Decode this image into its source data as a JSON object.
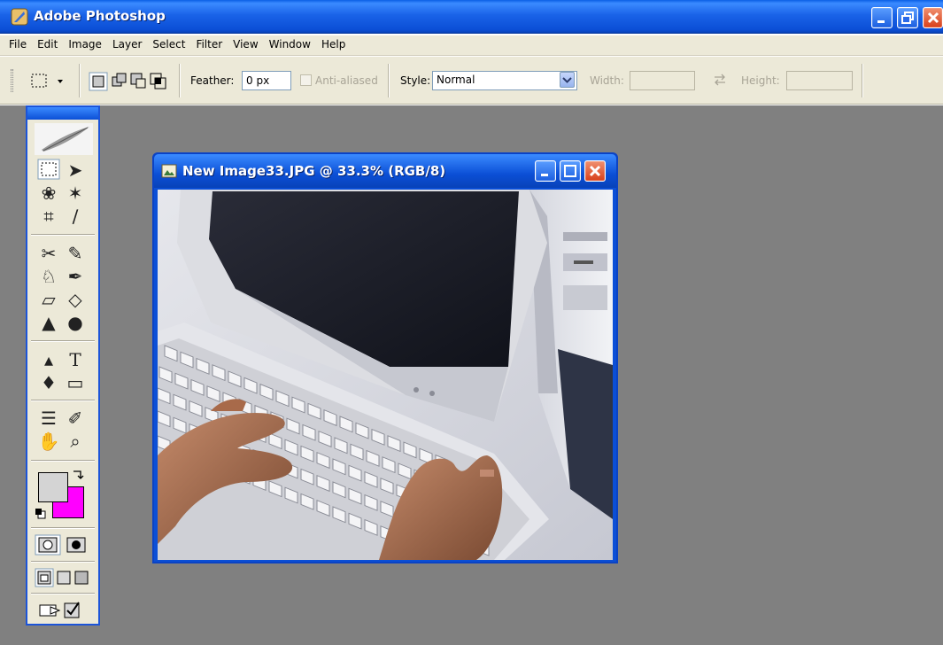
{
  "app": {
    "title": "Adobe Photoshop",
    "icon": "photoshop-feather-icon"
  },
  "menubar": {
    "items": [
      "File",
      "Edit",
      "Image",
      "Layer",
      "Select",
      "Filter",
      "View",
      "Window",
      "Help"
    ]
  },
  "options": {
    "marquee_tool_icon": "rectangular-marquee-icon",
    "selection_modes": [
      "new-selection-icon",
      "add-to-selection-icon",
      "subtract-from-selection-icon",
      "intersect-selection-icon"
    ],
    "feather_label": "Feather:",
    "feather_value": "0 px",
    "anti_aliased_label": "Anti-aliased",
    "style_label": "Style:",
    "style_value": "Normal",
    "width_label": "Width:",
    "width_value": "",
    "height_label": "Height:",
    "height_value": ""
  },
  "tools": {
    "items": [
      "rectangular-marquee-icon",
      "move-icon",
      "lasso-icon",
      "magic-wand-icon",
      "crop-icon",
      "slice-icon",
      "healing-brush-icon",
      "brush-icon",
      "clone-stamp-icon",
      "history-brush-icon",
      "eraser-icon",
      "paint-bucket-icon",
      "blur-icon",
      "dodge-icon",
      "path-selection-icon",
      "type-icon",
      "pen-icon",
      "rectangle-shape-icon",
      "notes-icon",
      "eyedropper-icon",
      "hand-icon",
      "zoom-icon"
    ],
    "foreground_color": "#d4d4d4",
    "background_color": "#ff00ff"
  },
  "document": {
    "title": "New Image33.JPG @ 33.3% (RGB/8)"
  },
  "colors": {
    "xp_blue": "#0b4fd6",
    "chrome": "#ece9d8",
    "workspace": "#808080"
  }
}
